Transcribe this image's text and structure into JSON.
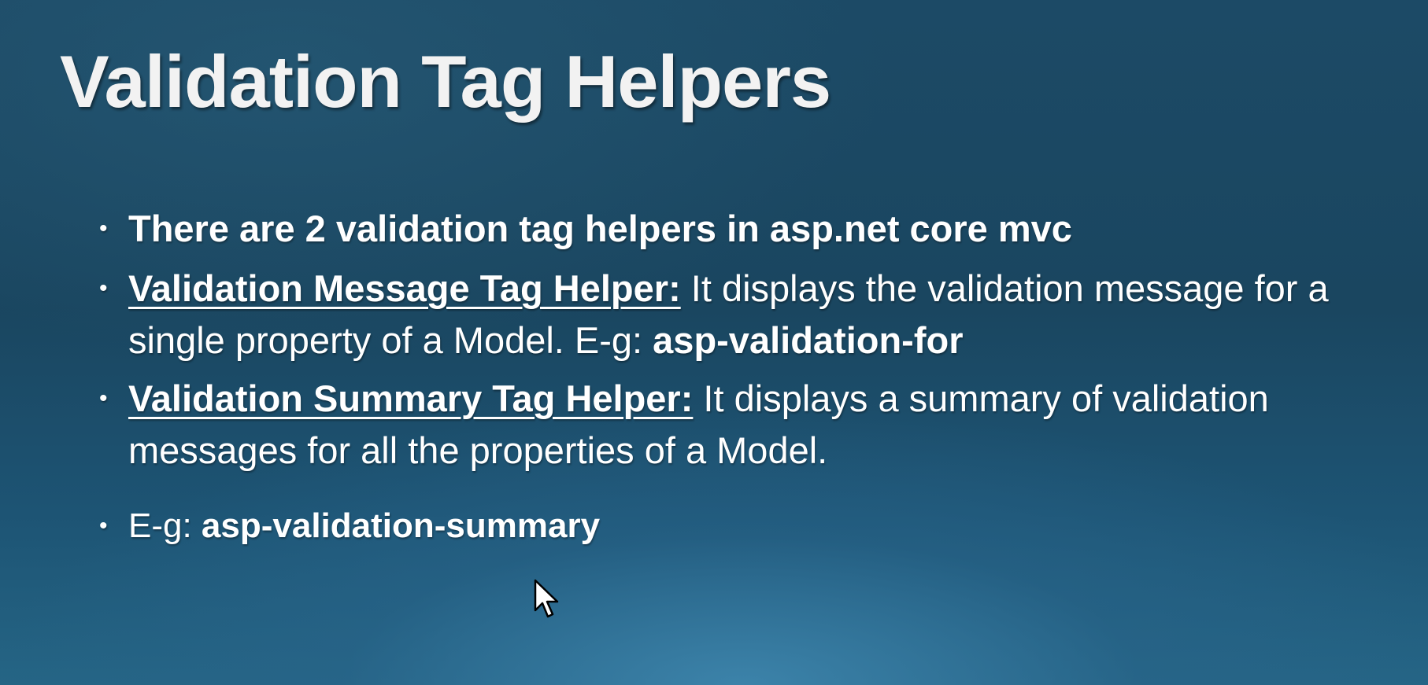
{
  "slide": {
    "title": "Validation Tag Helpers",
    "bullets": [
      {
        "text": "There are 2 validation tag helpers in asp.net core mvc"
      },
      {
        "heading": "Validation Message Tag Helper:",
        "text": " It displays the validation message for a single property of a Model. E-g: ",
        "code": "asp-validation-for"
      },
      {
        "heading": "Validation Summary Tag Helper:",
        "text": " It displays a summary of validation messages for all the properties of a Model."
      },
      {
        "text": "E-g: ",
        "code": "asp-validation-summary"
      }
    ],
    "bullet_glyph": "•"
  },
  "cursor": {
    "icon": "mouse-pointer-icon"
  },
  "colors": {
    "background_top": "#1c4a66",
    "background_bottom": "#256585",
    "text": "#ffffff"
  }
}
